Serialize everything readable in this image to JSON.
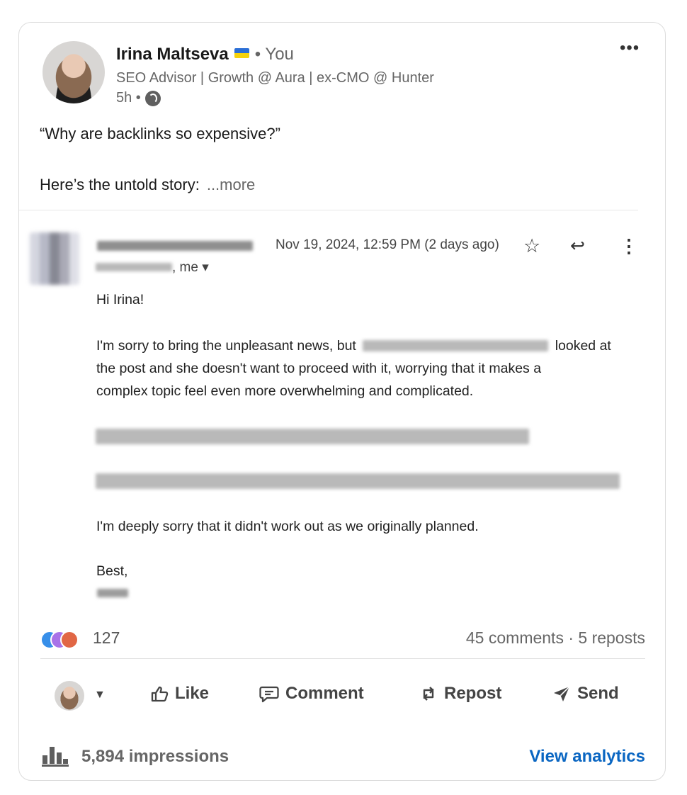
{
  "post": {
    "author_name": "Irina Maltseva",
    "you_label": "• You",
    "headline": "SEO Advisor | Growth @ Aura | ex-CMO @ Hunter",
    "time": "5h •",
    "more_options": "•••",
    "text_line1": "“Why are backlinks so expensive?”",
    "text_line2": "Here’s the untold story:",
    "see_more": "...more"
  },
  "email": {
    "date": "Nov 19, 2024, 12:59 PM (2 days ago)",
    "recipients_suffix": ", me",
    "greeting": "Hi Irina!",
    "para1_line1_start": "I'm sorry to bring the unpleasant news, but",
    "para1_line1_end": "looked at",
    "para1_line2": "the post and she doesn't want to proceed with it, worrying that it makes a",
    "para1_line3": "complex topic feel even more overwhelming and complicated.",
    "para3": "I'm deeply sorry that it didn't work out as we originally planned.",
    "signoff": "Best,"
  },
  "social": {
    "reaction_count": "127",
    "comments_reposts": "45 comments · 5 reposts"
  },
  "actions": {
    "like": "Like",
    "comment": "Comment",
    "repost": "Repost",
    "send": "Send"
  },
  "footer": {
    "impressions": "5,894 impressions",
    "view_analytics": "View analytics"
  },
  "colors": {
    "link_blue": "#0a66c2",
    "reaction_like": "#378fe9",
    "reaction_support": "#a872e8",
    "reaction_love": "#e16745"
  }
}
